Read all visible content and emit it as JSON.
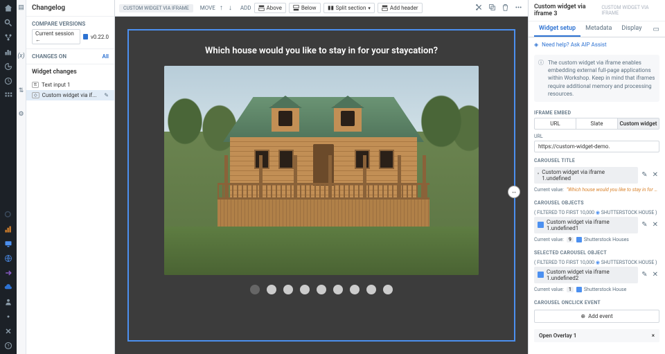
{
  "changelog": {
    "title": "Changelog",
    "compare_label": "COMPARE VERSIONS",
    "current_session": "Current session",
    "version": "v0.22.0",
    "changes_on": "CHANGES ON",
    "all": "All",
    "widget_changes": "Widget changes",
    "items": {
      "text_input": "Text input 1",
      "custom_widget": "Custom widget via if..."
    }
  },
  "toolbar": {
    "crumb": "CUSTOM WIDGET VIA IFRAME",
    "move": "MOVE",
    "add": "ADD",
    "above": "Above",
    "below": "Below",
    "split": "Split section",
    "header": "Add header"
  },
  "canvas": {
    "question": "Which house would you like to stay in for your staycation?",
    "dot_count": 9,
    "active_dot": 0
  },
  "inspector": {
    "title": "Custom widget via iframe 3",
    "crumb": "CUSTOM WIDGET VIA IFRAME",
    "tabs": {
      "setup": "Widget setup",
      "metadata": "Metadata",
      "display": "Display"
    },
    "help": "Need help? Ask AIP Assist",
    "info": "The custom widget via iframe enables embedding external full-page applications within Workshop. Keep in mind that iframes require additional memory and processing resources.",
    "iframe_embed": "IFRAME EMBED",
    "seg": {
      "url": "URL",
      "slate": "Slate",
      "custom": "Custom widget"
    },
    "url_label": "URL",
    "url_value": "https://custom-widget-demo.",
    "carousel_title_label": "CAROUSEL TITLE",
    "carousel_title_chip": "Custom widget via iframe 1.undefined",
    "curval_label": "Current value:",
    "carousel_title_val": "\"Which house would you like to stay in for your sta...\"",
    "carousel_objects_label": "CAROUSEL OBJECTS",
    "filtered": "( FILTERED TO FIRST 10,000",
    "house_type": "SHUTTERSTOCK HOUSE )",
    "carousel_obj_chip": "Custom widget via iframe 1.undefined1",
    "carousel_obj_count": "9",
    "carousel_obj_val": "Shutterstock Houses",
    "selected_label": "SELECTED CAROUSEL OBJECT",
    "selected_chip": "Custom widget via iframe 1.undefined2",
    "selected_count": "1",
    "selected_val": "Shutterstock House",
    "onclick_label": "CAROUSEL ONCLICK EVENT",
    "add_event": "Add event",
    "overlay": "Open Overlay 1"
  }
}
